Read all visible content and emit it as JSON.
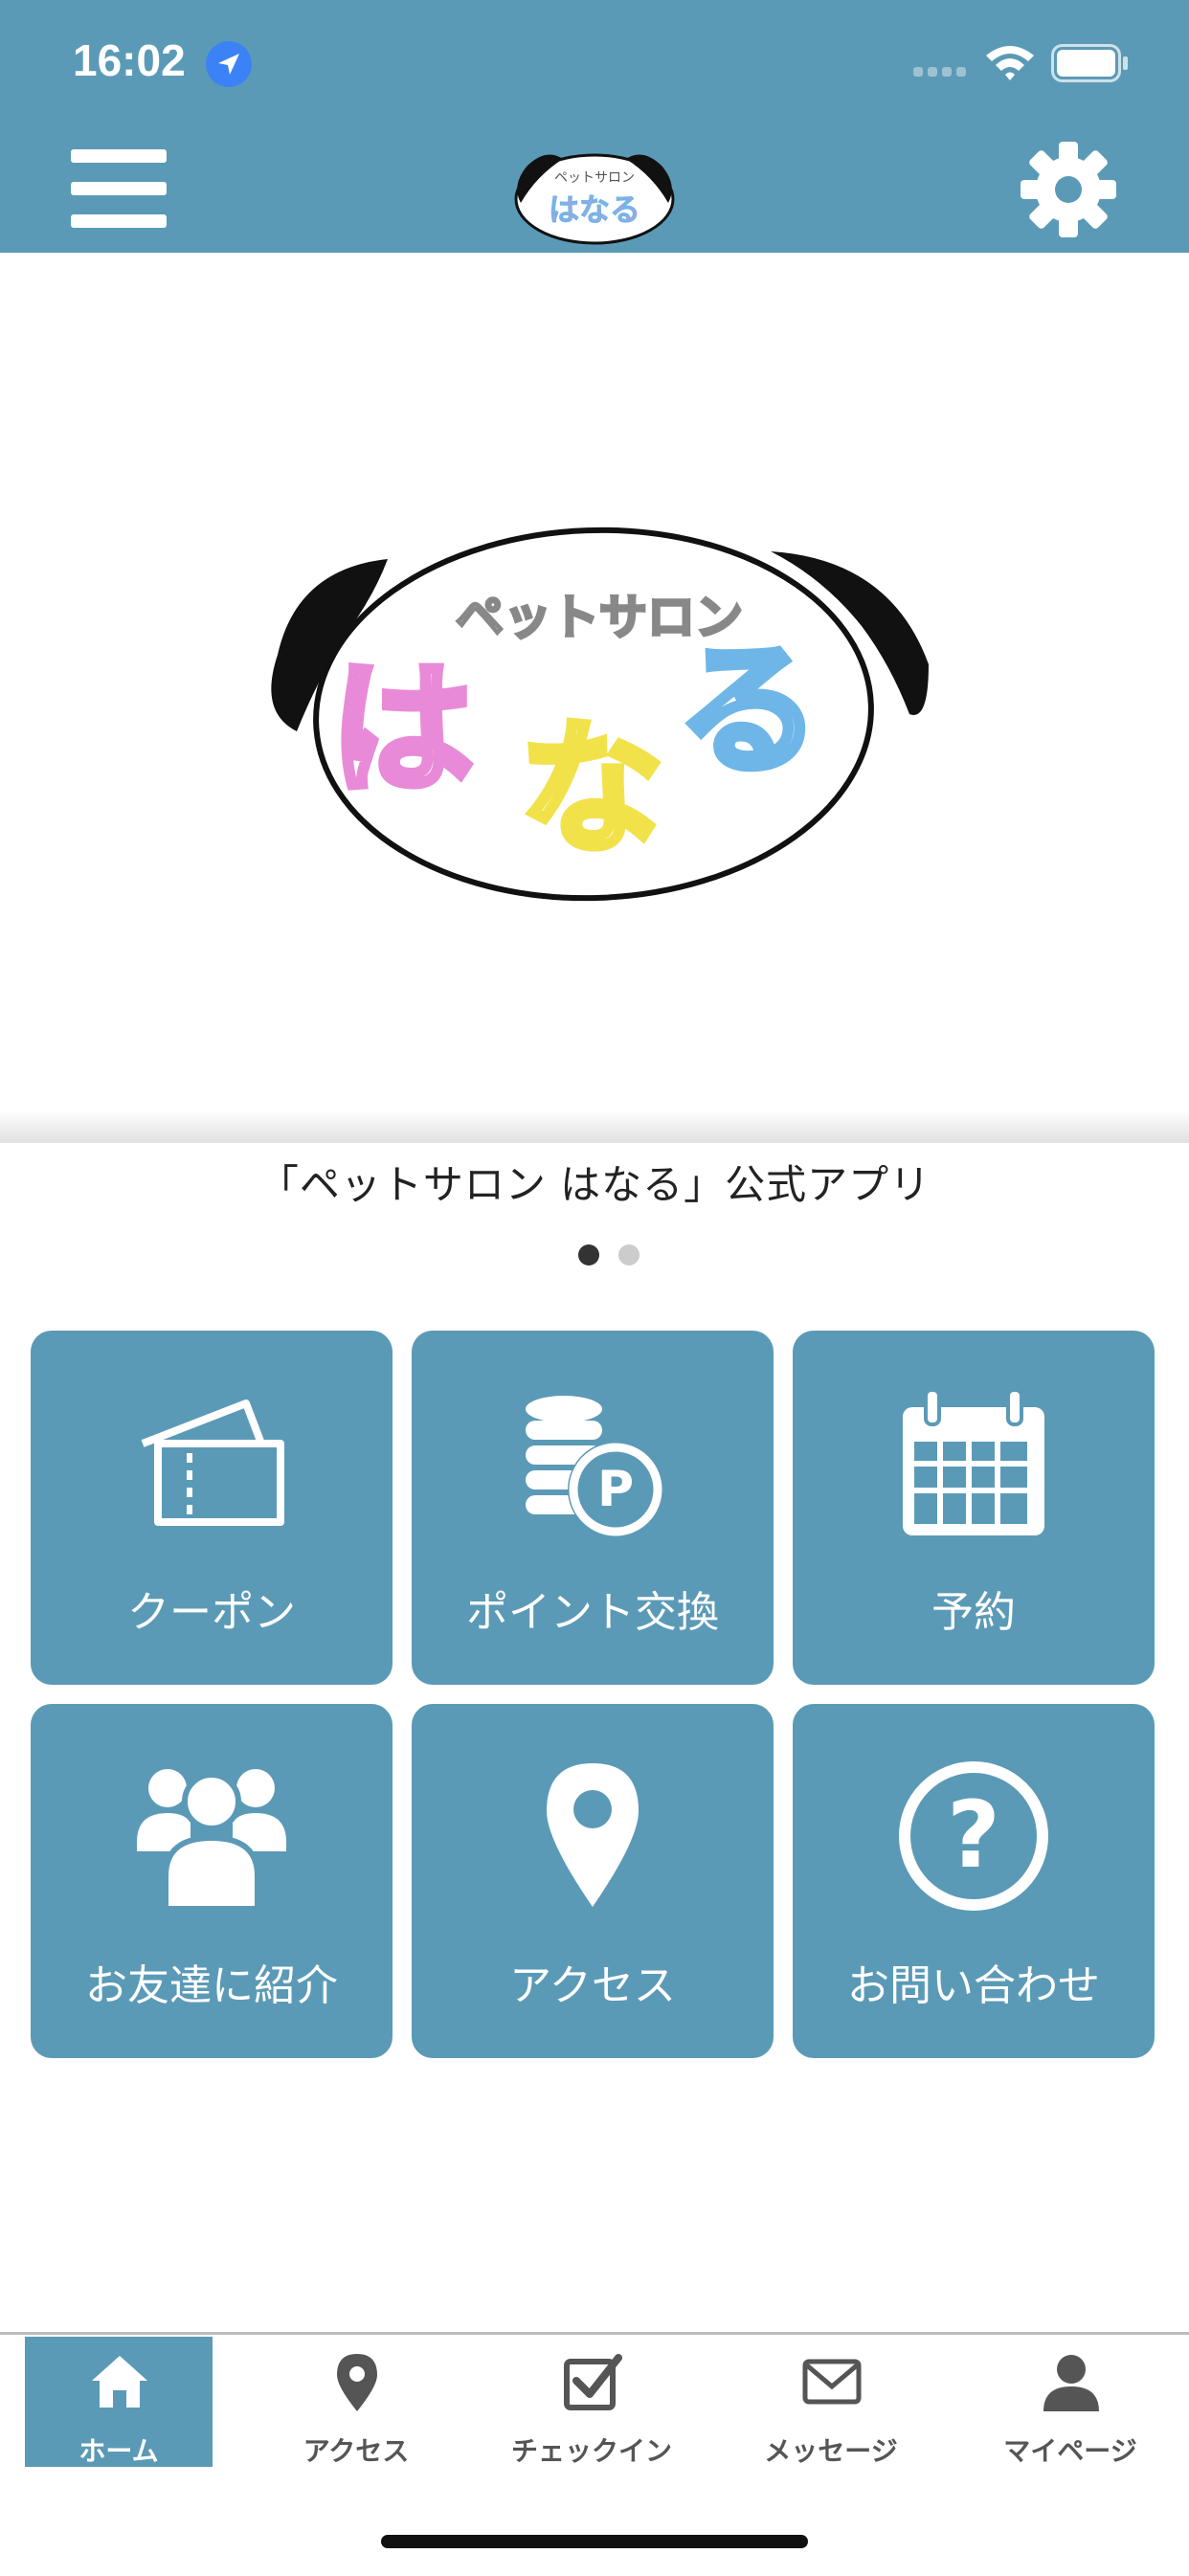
{
  "status_bar": {
    "time": "16:02"
  },
  "header": {
    "logo_small_text_top": "ペットサロン",
    "logo_small_text_main": "はなる"
  },
  "hero": {
    "logo_text_top": "ペットサロン",
    "logo_text_ha": "は",
    "logo_text_na": "な",
    "logo_text_ru": "る",
    "caption": "「ペットサロン はなる」公式アプリ",
    "slide_count": 2,
    "active_slide": 1
  },
  "menu_tiles": [
    {
      "label": "クーポン",
      "icon": "ticket-icon"
    },
    {
      "label": "ポイント交換",
      "icon": "coins-point-icon"
    },
    {
      "label": "予約",
      "icon": "calendar-icon"
    },
    {
      "label": "お友達に紹介",
      "icon": "users-icon"
    },
    {
      "label": "アクセス",
      "icon": "map-pin-icon"
    },
    {
      "label": "お問い合わせ",
      "icon": "question-circle-icon"
    }
  ],
  "tabbar": {
    "items": [
      {
        "label": "ホーム",
        "icon": "home-icon",
        "active": true
      },
      {
        "label": "アクセス",
        "icon": "map-pin-icon",
        "active": false
      },
      {
        "label": "チェックイン",
        "icon": "checkin-icon",
        "active": false
      },
      {
        "label": "メッセージ",
        "icon": "envelope-icon",
        "active": false
      },
      {
        "label": "マイページ",
        "icon": "user-icon",
        "active": false
      }
    ]
  },
  "colors": {
    "brand": "#5b9ab6",
    "pink": "#e98ad8",
    "yellow": "#f2e24a",
    "blue": "#6fb6e8"
  }
}
